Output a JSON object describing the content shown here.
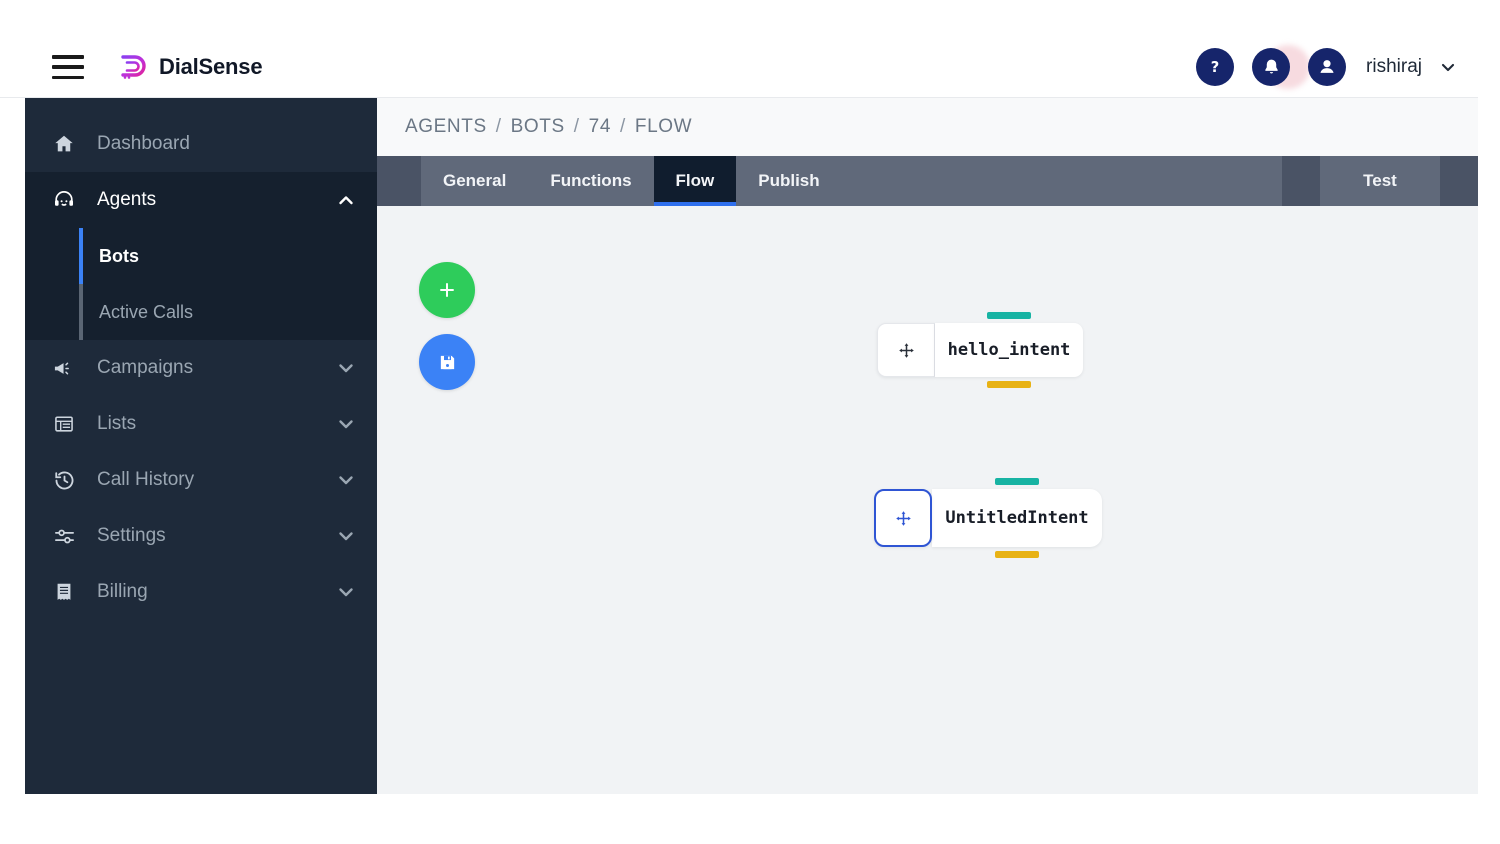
{
  "header": {
    "menu_icon": "hamburger-icon",
    "brand_name": "DialSense",
    "brand_logo": "dialsense-logo",
    "help_icon": "question-mark-icon",
    "notifications_icon": "bell-icon",
    "avatar_icon": "user-avatar-icon",
    "user_name": "rishiraj",
    "caret_icon": "chevron-down-icon"
  },
  "sidebar": {
    "items": [
      {
        "label": "Dashboard",
        "icon": "home-icon",
        "expandable": false,
        "state": ""
      },
      {
        "label": "Agents",
        "icon": "headset-agent-icon",
        "expandable": true,
        "state": "expanded",
        "chevron": "chevron-up-icon"
      },
      {
        "label": "Campaigns",
        "icon": "megaphone-icon",
        "expandable": true,
        "state": "collapsed",
        "chevron": "chevron-down-icon"
      },
      {
        "label": "Lists",
        "icon": "table-list-icon",
        "expandable": true,
        "state": "collapsed",
        "chevron": "chevron-down-icon"
      },
      {
        "label": "Call History",
        "icon": "history-clock-icon",
        "expandable": true,
        "state": "collapsed",
        "chevron": "chevron-down-icon"
      },
      {
        "label": "Settings",
        "icon": "sliders-icon",
        "expandable": true,
        "state": "collapsed",
        "chevron": "chevron-down-icon"
      },
      {
        "label": "Billing",
        "icon": "receipt-icon",
        "expandable": true,
        "state": "collapsed",
        "chevron": "chevron-down-icon"
      }
    ],
    "agents_children": [
      {
        "label": "Bots",
        "active": true
      },
      {
        "label": "Active Calls",
        "active": false
      }
    ],
    "colors": {
      "background": "#1e2a3a",
      "active_background": "#15202e",
      "active_accent": "#3b82f6",
      "inactive_bar": "#5a6573",
      "text": "#9aa6b2",
      "active_text": "#ffffff"
    }
  },
  "breadcrumb": {
    "crumbs": [
      "AGENTS",
      "BOTS",
      "74",
      "FLOW"
    ],
    "separator": "/"
  },
  "tabs": {
    "items": [
      {
        "label": "General",
        "active": false
      },
      {
        "label": "Functions",
        "active": false
      },
      {
        "label": "Flow",
        "active": true
      },
      {
        "label": "Publish",
        "active": false
      }
    ],
    "right_action": {
      "label": "Test"
    },
    "colors": {
      "bar": "#60697a",
      "pad": "#4a5365",
      "active_bg": "#101d2e",
      "active_underline": "#2f6fed"
    }
  },
  "canvas": {
    "background": "#f1f3f5",
    "toolbar": [
      {
        "name": "add-node-button",
        "icon": "plus-icon",
        "color": "#2ecc5b"
      },
      {
        "name": "save-flow-button",
        "icon": "save-disk-icon",
        "color": "#3b82f6"
      }
    ],
    "nodes": [
      {
        "title": "hello_intent",
        "handle_icon": "move-arrows-icon",
        "selected": false,
        "input_port_color": "#17b3a3",
        "output_port_color": "#e8b215"
      },
      {
        "title": "UntitledIntent",
        "handle_icon": "move-arrows-icon",
        "selected": true,
        "input_port_color": "#17b3a3",
        "output_port_color": "#e8b215"
      }
    ]
  }
}
